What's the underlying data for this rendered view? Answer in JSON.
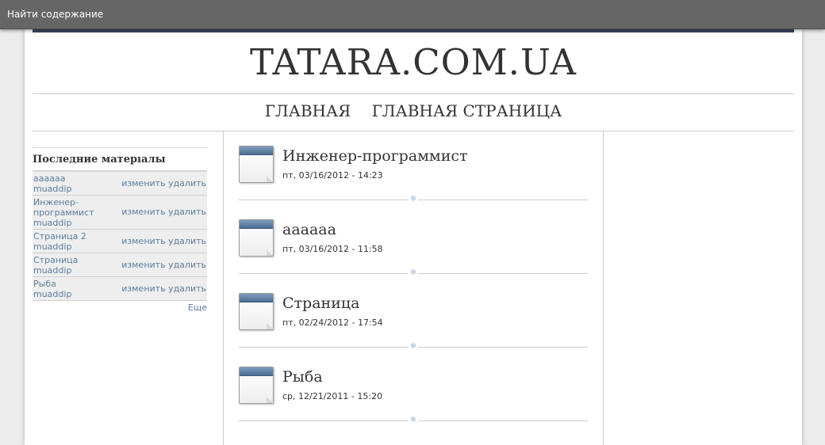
{
  "skip_link": "Найти содержание",
  "site_name": "TATARA.COM.UA",
  "main_menu": [
    "ГЛАВНАЯ",
    "ГЛАВНАЯ СТРАНИЦА"
  ],
  "sidebar": {
    "title": "Последние матерıалы",
    "rows": [
      {
        "title": "аааааа",
        "author": "muaddip",
        "edit": "изменить",
        "delete": "удалить"
      },
      {
        "title": "Инженер-программист",
        "author": "muaddip",
        "edit": "изменить",
        "delete": "удалить"
      },
      {
        "title": "Страница 2",
        "author": "muaddip",
        "edit": "изменить",
        "delete": "удалить"
      },
      {
        "title": "Страница",
        "author": "muaddip",
        "edit": "изменить",
        "delete": "удалить"
      },
      {
        "title": "Рыба",
        "author": "muaddip",
        "edit": "изменить",
        "delete": "удалить"
      }
    ],
    "more": "Еще"
  },
  "nodes": [
    {
      "title": "Инженер-программист",
      "date": "пт, 03/16/2012 - 14:23"
    },
    {
      "title": "аааааа",
      "date": "пт, 03/16/2012 - 11:58"
    },
    {
      "title": "Страница",
      "date": "пт, 02/24/2012 - 17:54"
    },
    {
      "title": "Рыба",
      "date": "ср, 12/21/2011 - 15:20"
    }
  ],
  "separator_glyph": "❄",
  "colors": {
    "topbar": "#666666",
    "accent": "#3a4a5f",
    "link": "#5b7d9f",
    "calendar_head": "#4b6d93"
  }
}
